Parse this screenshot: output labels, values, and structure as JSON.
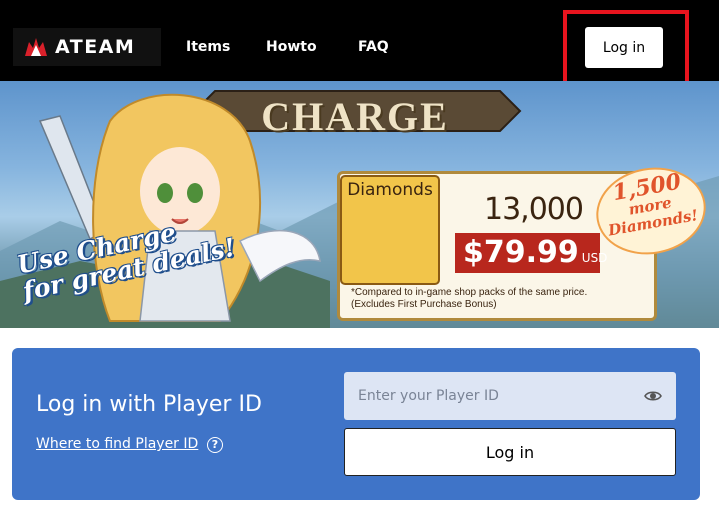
{
  "header": {
    "logo_text": "ATEAM",
    "nav": [
      {
        "label": "Items"
      },
      {
        "label": "Howto"
      },
      {
        "label": "FAQ"
      }
    ],
    "login_label": "Log in"
  },
  "banner": {
    "title": "CHARGE",
    "slogan_line1": "Use Charge",
    "slogan_line2": "for great deals!",
    "diamonds_label": "Diamonds",
    "diamond_amount": "13,000",
    "price": "$79.99",
    "currency": "USD",
    "footnote_line1": "*Compared to in-game shop packs of the same price.",
    "footnote_line2": "(Excludes First Purchase Bonus)",
    "bonus_amount": "1,500",
    "bonus_line1": "more",
    "bonus_line2": "Diamonds!"
  },
  "login_panel": {
    "title": "Log in with Player ID",
    "help_link": "Where to find Player ID",
    "help_icon": "?",
    "input_placeholder": "Enter your Player ID",
    "submit_label": "Log in"
  },
  "colors": {
    "header_bg": "#000000",
    "highlight": "#e8141e",
    "panel_bg": "#3f74c8",
    "price_bg": "#b8271d"
  },
  "icons": [
    "logo-icon",
    "eye-icon",
    "help-icon",
    "diamond-icon"
  ]
}
